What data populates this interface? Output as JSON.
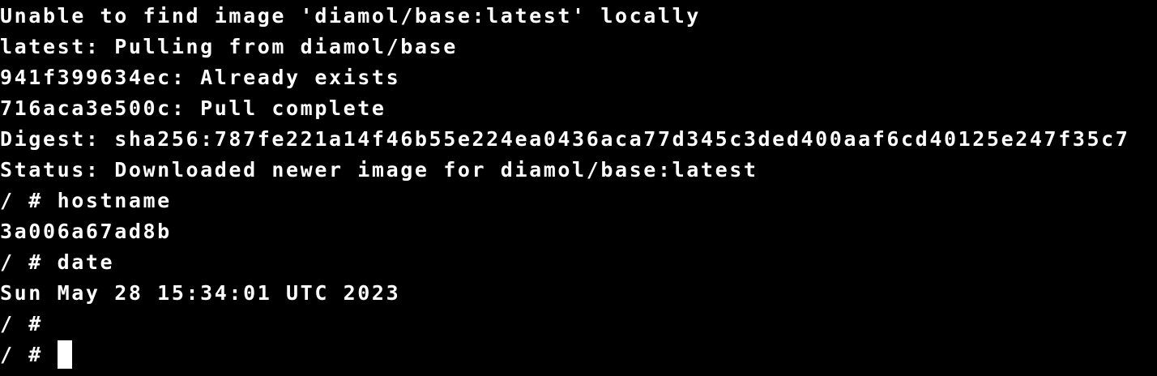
{
  "terminal": {
    "lines": [
      "Unable to find image 'diamol/base:latest' locally",
      "latest: Pulling from diamol/base",
      "941f399634ec: Already exists",
      "716aca3e500c: Pull complete",
      "Digest: sha256:787fe221a14f46b55e224ea0436aca77d345c3ded400aaf6cd40125e247f35c7",
      "Status: Downloaded newer image for diamol/base:latest",
      "/ # hostname",
      "3a006a67ad8b",
      "/ # date",
      "Sun May 28 15:34:01 UTC 2023",
      "/ #",
      "/ # "
    ],
    "colors": {
      "background": "#000000",
      "foreground": "#ffffff",
      "cursor": "#ffffff"
    }
  }
}
